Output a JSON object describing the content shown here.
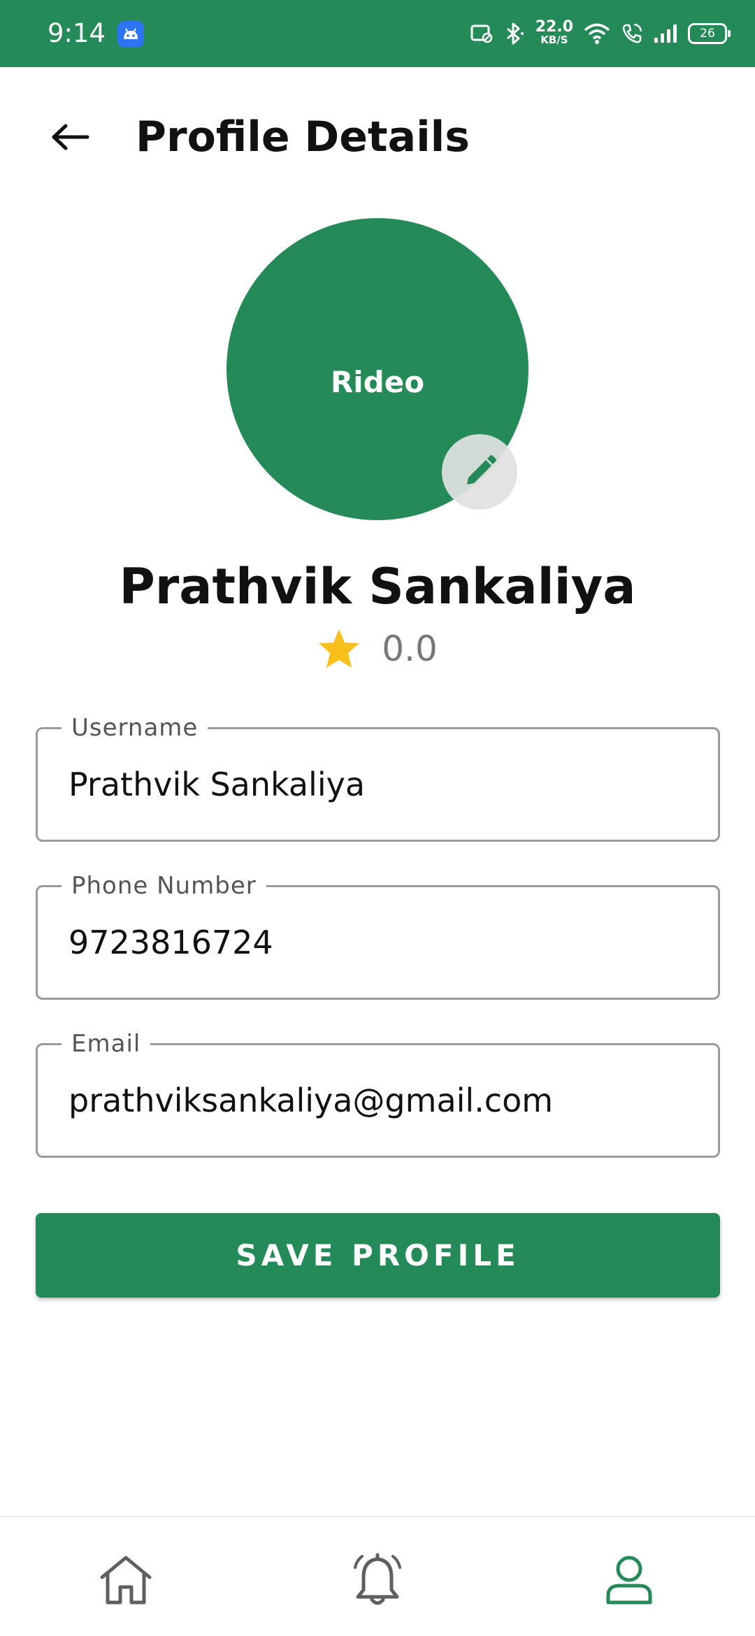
{
  "status_bar": {
    "time": "9:14",
    "net_speed_value": "22.0",
    "net_speed_unit": "KB/S",
    "battery_level": "26"
  },
  "header": {
    "title": "Profile Details",
    "back_icon": "arrow-left-icon"
  },
  "avatar": {
    "label": "Rideo",
    "edit_icon": "pencil-icon"
  },
  "profile": {
    "name": "Prathvik Sankaliya",
    "rating": "0.0",
    "rating_icon": "star-icon"
  },
  "form": {
    "username": {
      "label": "Username",
      "value": "Prathvik Sankaliya"
    },
    "phone": {
      "label": "Phone Number",
      "value": "9723816724"
    },
    "email": {
      "label": "Email",
      "value": "prathviksankaliya@gmail.com"
    },
    "save_label": "SAVE PROFILE"
  },
  "bottom_nav": {
    "items": [
      {
        "icon": "home-icon",
        "active": false
      },
      {
        "icon": "bell-icon",
        "active": false
      },
      {
        "icon": "user-icon",
        "active": true
      }
    ]
  },
  "colors": {
    "primary": "#248a58",
    "star": "#f9c01c",
    "border": "#9a9a9a",
    "nav_inactive": "#5f5f5f"
  }
}
